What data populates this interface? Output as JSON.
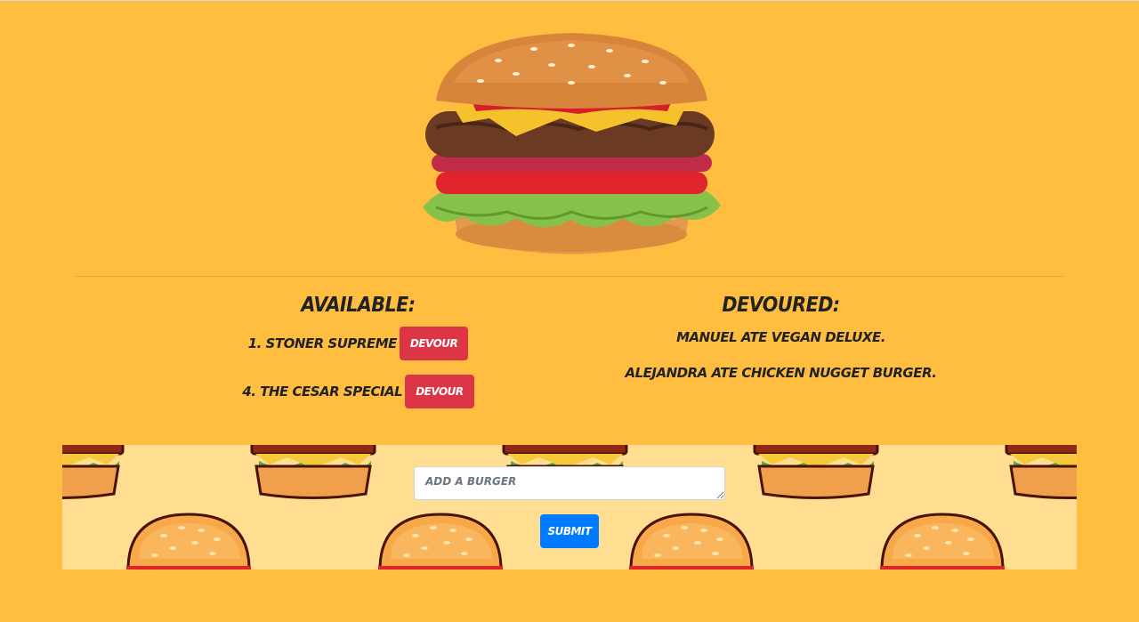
{
  "available": {
    "heading": "AVAILABLE:",
    "items": [
      {
        "label": "1. STONER SUPREME",
        "button": "DEVOUR"
      },
      {
        "label": "4. THE CESAR SPECIAL",
        "button": "DEVOUR"
      }
    ]
  },
  "devoured": {
    "heading": "DEVOURED:",
    "items": [
      "MANUEL ATE VEGAN DELUXE.",
      "ALEJANDRA ATE CHICKEN NUGGET BURGER."
    ]
  },
  "form": {
    "placeholder": "ADD A BURGER",
    "submit_label": "SUBMIT"
  },
  "colors": {
    "background": "#FFBE3F",
    "devour_button": "#DC3545",
    "submit_button": "#007BFF",
    "form_panel": "#FFDD91"
  },
  "icons": {
    "hero": "cheeseburger-image",
    "pattern": "burger-pattern"
  }
}
